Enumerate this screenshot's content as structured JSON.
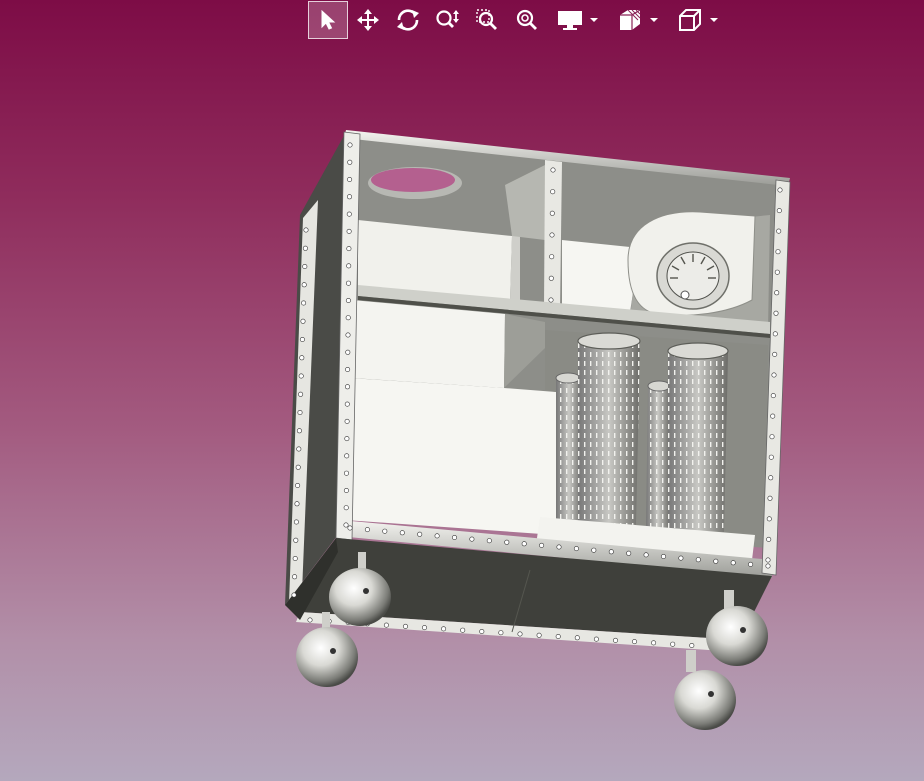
{
  "viewer": {
    "background_top": "#7d0c46",
    "background_bottom": "#b4a8bd",
    "toolbar": [
      {
        "id": "select",
        "icon": "cursor-arrow-icon",
        "active": true
      },
      {
        "id": "pan",
        "icon": "pan-move-icon",
        "active": false
      },
      {
        "id": "rotate",
        "icon": "rotate-icon",
        "active": false
      },
      {
        "id": "zoom",
        "icon": "zoom-icon",
        "active": false
      },
      {
        "id": "zoom-window",
        "icon": "zoom-window-icon",
        "active": false
      },
      {
        "id": "zoom-fit",
        "icon": "zoom-fit-icon",
        "active": false
      },
      {
        "id": "display-mode",
        "icon": "monitor-icon",
        "active": false,
        "dropdown": true
      },
      {
        "id": "section-view",
        "icon": "section-view-icon",
        "active": false,
        "dropdown": true
      },
      {
        "id": "view-orientation",
        "icon": "cube-view-icon",
        "active": false,
        "dropdown": true
      }
    ]
  }
}
